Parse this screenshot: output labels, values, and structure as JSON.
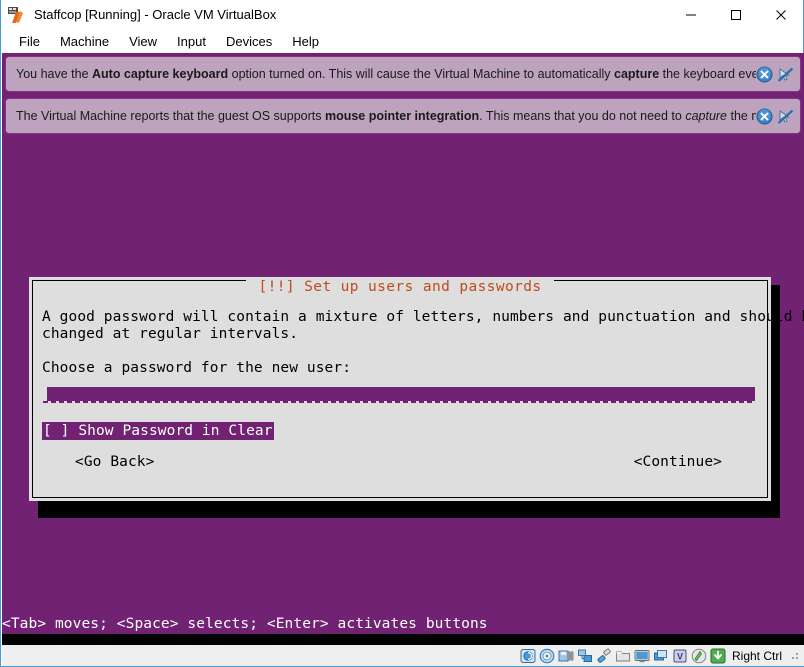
{
  "window": {
    "title": "Staffcop [Running] - Oracle VM VirtualBox",
    "icon": "virtualbox-icon",
    "minimize_label": "Minimize",
    "maximize_label": "Maximize",
    "close_label": "Close"
  },
  "menubar": {
    "items": [
      {
        "label": "File"
      },
      {
        "label": "Machine"
      },
      {
        "label": "View"
      },
      {
        "label": "Input"
      },
      {
        "label": "Devices"
      },
      {
        "label": "Help"
      }
    ]
  },
  "notifications": [
    {
      "id": "auto-capture-keyboard",
      "parts": [
        {
          "text": "You have the ",
          "style": "normal"
        },
        {
          "text": "Auto capture keyboard",
          "style": "bold"
        },
        {
          "text": " option turned on. This will cause the Virtual Machine to automatically ",
          "style": "normal"
        },
        {
          "text": "capture",
          "style": "bold"
        },
        {
          "text": " the keyboard every time the VM",
          "style": "normal"
        }
      ],
      "close_icon": "close-icon",
      "dismiss_icon": "do-not-show-again-icon"
    },
    {
      "id": "mouse-pointer-integration",
      "parts": [
        {
          "text": "The Virtual Machine reports that the guest OS supports ",
          "style": "normal"
        },
        {
          "text": "mouse pointer integration",
          "style": "bold"
        },
        {
          "text": ". This means that you do not need to ",
          "style": "normal"
        },
        {
          "text": "capture",
          "style": "italic"
        },
        {
          "text": " the mouse pointer",
          "style": "normal"
        }
      ],
      "close_icon": "close-icon",
      "dismiss_icon": "do-not-show-again-icon"
    }
  ],
  "installer": {
    "dialog_title": "[!!] Set up users and passwords",
    "body_line_1": "A good password will contain a mixture of letters, numbers and punctuation and should be",
    "body_line_2": "changed at regular intervals.",
    "prompt": "Choose a password for the new user:",
    "password_value": "",
    "password_placeholder": "",
    "checkbox_label": "[ ] Show Password in Clear",
    "checkbox_checked": false,
    "go_back_label": "<Go Back>",
    "continue_label": "<Continue>",
    "help_line": "<Tab> moves; <Space> selects; <Enter> activates buttons",
    "colors": {
      "background": "#722272",
      "dialog_bg": "#dedede",
      "title_fg": "#c14a1e",
      "highlight_bg": "#722272",
      "highlight_fg": "#ffffff"
    }
  },
  "statusbar": {
    "icons": [
      {
        "name": "hard-disk-icon"
      },
      {
        "name": "optical-drive-icon"
      },
      {
        "name": "floppy-drive-icon"
      },
      {
        "name": "network-icon"
      },
      {
        "name": "usb-icon"
      },
      {
        "name": "shared-folders-icon"
      },
      {
        "name": "display-icon"
      },
      {
        "name": "recording-icon"
      },
      {
        "name": "virtualization-icon"
      },
      {
        "name": "mouse-integration-icon"
      },
      {
        "name": "host-key-icon"
      }
    ],
    "host_key": "Right Ctrl"
  }
}
